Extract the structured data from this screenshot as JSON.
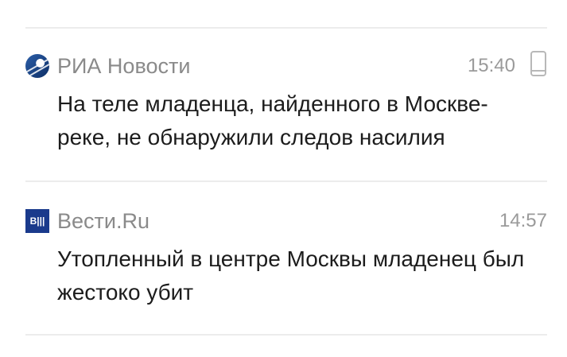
{
  "news": [
    {
      "source": "РИА Новости",
      "source_icon": "ria-novosti-logo-icon",
      "time": "15:40",
      "device_icon": "mobile-phone-icon",
      "headline": "На теле младенца, найденного в Москве-реке, не обнаружили следов насилия"
    },
    {
      "source": "Вести.Ru",
      "source_icon": "vesti-logo-icon",
      "time": "14:57",
      "headline": "Утопленный в центре Москвы младенец был жестоко убит"
    }
  ],
  "vesti_logo_text": "В|||"
}
